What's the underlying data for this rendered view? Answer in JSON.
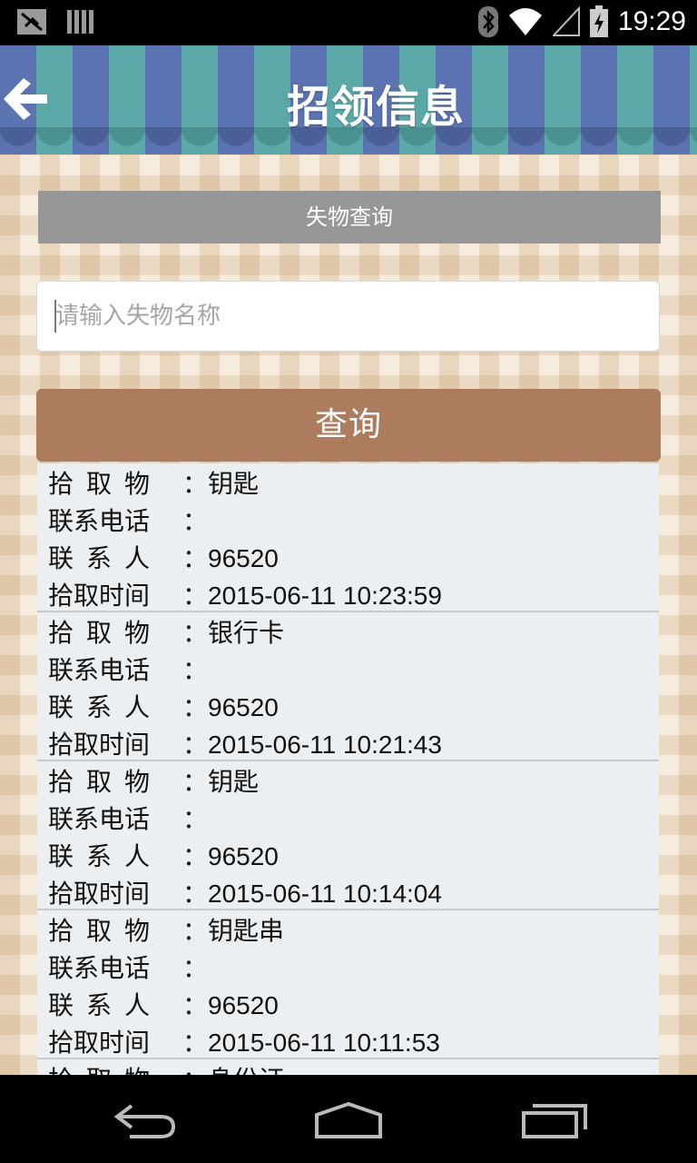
{
  "status_bar": {
    "time": "19:29",
    "icons": [
      "notification-icon",
      "signal-bars-icon",
      "bluetooth-icon",
      "wifi-icon",
      "cell-signal-icon",
      "battery-charging-icon"
    ]
  },
  "header": {
    "title": "招领信息",
    "back_icon": "arrow-left-icon"
  },
  "section": {
    "title": "失物查询"
  },
  "search": {
    "placeholder": "请输入失物名称",
    "value": ""
  },
  "query_button": {
    "label": "查询"
  },
  "labels": {
    "item": "拾取物",
    "phone": "联系电话",
    "contact": "联系人",
    "time": "拾取时间",
    "separator": "："
  },
  "records": [
    {
      "item": "钥匙",
      "phone": "",
      "contact": "96520",
      "time": "2015-06-11 10:23:59"
    },
    {
      "item": "银行卡",
      "phone": "",
      "contact": "96520",
      "time": "2015-06-11 10:21:43"
    },
    {
      "item": "钥匙",
      "phone": "",
      "contact": "96520",
      "time": "2015-06-11 10:14:04"
    },
    {
      "item": "钥匙串",
      "phone": "",
      "contact": "96520",
      "time": "2015-06-11 10:11:53"
    },
    {
      "item": "身份证",
      "phone": "",
      "contact": "",
      "time": ""
    }
  ],
  "nav_bar": {
    "icons": [
      "back-nav-icon",
      "home-nav-icon",
      "recents-nav-icon"
    ]
  }
}
